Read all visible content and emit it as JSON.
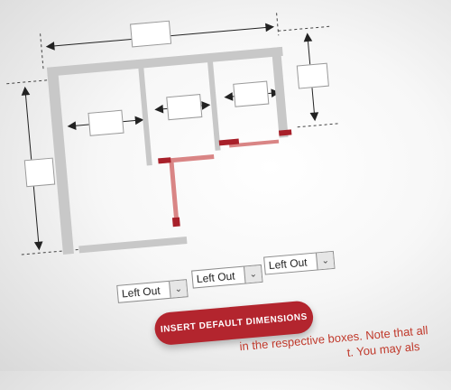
{
  "dimension_inputs": [
    "",
    "",
    "",
    "",
    "",
    "",
    ""
  ],
  "door_selects": [
    {
      "value": "Left Out"
    },
    {
      "value": "Left Out"
    },
    {
      "value": "Left Out"
    }
  ],
  "insert_button": {
    "label": "INSERT DEFAULT DIMENSIONS"
  },
  "note": {
    "line1": "in the respective boxes. Note that all",
    "line2": "t. You may als"
  },
  "colors": {
    "wall": "#c8c8c8",
    "door_open": "#d98585",
    "door_closed": "#a8202a",
    "button": "#b3252e",
    "note_text": "#c0392b"
  }
}
